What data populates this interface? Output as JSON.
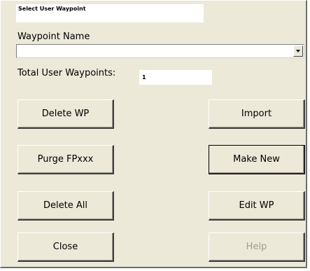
{
  "header": {
    "title": "Select User Waypoint"
  },
  "waypoint_name": {
    "label": "Waypoint Name",
    "value": ""
  },
  "total_waypoints": {
    "label": "Total User Waypoints:",
    "value": "1"
  },
  "buttons": {
    "delete_wp": "Delete WP",
    "purge": "Purge FPxxx",
    "delete_all": "Delete All",
    "close": "Close",
    "import": "Import",
    "make_new": "Make New",
    "edit_wp": "Edit WP",
    "help": "Help"
  },
  "state": {
    "help_enabled": false,
    "default_button": "Make New"
  },
  "colors": {
    "dialog_bg": "#ece9d8",
    "disabled_text": "#a09d93"
  }
}
